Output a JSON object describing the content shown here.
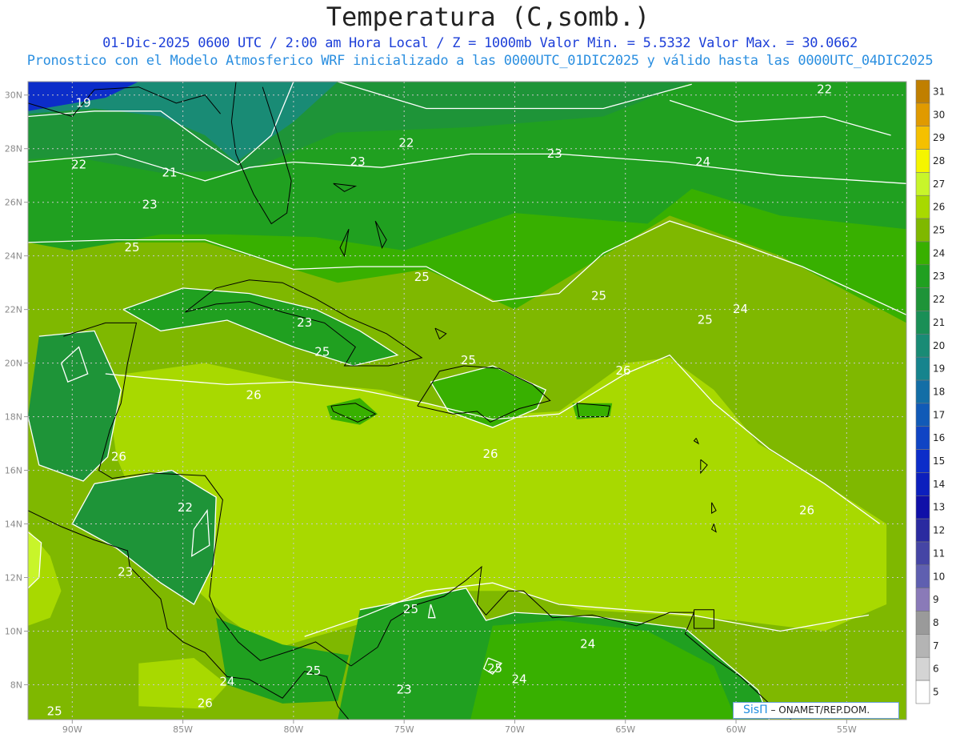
{
  "title": "Temperatura (C,somb.)",
  "subtitle1": "01-Dic-2025  0600 UTC / 2:00 am Hora Local / Z = 1000mb    Valor Min. = 5.5332  Valor Max. = 30.0662",
  "subtitle2": "Pronostico con el Modelo Atmosferico WRF inicializado a las 0000UTC_01DIC2025 y válido hasta las  0000UTC_04DIC2025",
  "credit": {
    "logo": "SisΠ",
    "text": "– ONAMET/REP.DOM."
  },
  "axes": {
    "lon_labels": [
      "90W",
      "85W",
      "80W",
      "75W",
      "70W",
      "65W",
      "60W",
      "55W"
    ],
    "lat_labels": [
      "30N",
      "28N",
      "26N",
      "24N",
      "22N",
      "20N",
      "18N",
      "16N",
      "14N",
      "12N",
      "10N",
      "8N"
    ],
    "lon_range": [
      -92,
      -52.3
    ],
    "lat_range": [
      6.7,
      30.5
    ],
    "grid": "dotted"
  },
  "colorbar": {
    "levels": [
      31,
      30,
      29,
      28,
      27,
      26,
      25,
      24,
      23,
      22,
      21,
      20,
      19,
      18,
      17,
      16,
      15,
      14,
      13,
      12,
      11,
      10,
      9,
      8,
      7,
      6,
      5
    ],
    "colors": [
      "#c07f00",
      "#e09a00",
      "#f5c000",
      "#f5f500",
      "#c8f52a",
      "#a8d900",
      "#7fb800",
      "#38b000",
      "#20a020",
      "#1e9438",
      "#1a8f56",
      "#198b75",
      "#16848d",
      "#136ea6",
      "#115ab7",
      "#0f44c4",
      "#0c2dc9",
      "#0c1fbd",
      "#1010a8",
      "#2a2aa0",
      "#4545a5",
      "#5f5fb0",
      "#8a7ab8",
      "#9a9a9a",
      "#b4b4b4",
      "#d4d4d4",
      "#ffffff"
    ]
  },
  "contour_labels": [
    {
      "text": "19",
      "lon": -89.5,
      "lat": 29.7
    },
    {
      "text": "22",
      "lon": -56.0,
      "lat": 30.2
    },
    {
      "text": "22",
      "lon": -74.9,
      "lat": 28.2
    },
    {
      "text": "22",
      "lon": -89.7,
      "lat": 27.4
    },
    {
      "text": "21",
      "lon": -85.6,
      "lat": 27.1
    },
    {
      "text": "23",
      "lon": -77.1,
      "lat": 27.5
    },
    {
      "text": "23",
      "lon": -68.2,
      "lat": 27.8
    },
    {
      "text": "24",
      "lon": -61.5,
      "lat": 27.5
    },
    {
      "text": "23",
      "lon": -86.5,
      "lat": 25.9
    },
    {
      "text": "25",
      "lon": -87.3,
      "lat": 24.3
    },
    {
      "text": "25",
      "lon": -74.2,
      "lat": 23.2
    },
    {
      "text": "25",
      "lon": -66.2,
      "lat": 22.5
    },
    {
      "text": "24",
      "lon": -59.8,
      "lat": 22.0
    },
    {
      "text": "25",
      "lon": -61.4,
      "lat": 21.6
    },
    {
      "text": "23",
      "lon": -79.5,
      "lat": 21.5
    },
    {
      "text": "25",
      "lon": -78.7,
      "lat": 20.4
    },
    {
      "text": "25",
      "lon": -72.1,
      "lat": 20.1
    },
    {
      "text": "26",
      "lon": -65.1,
      "lat": 19.7
    },
    {
      "text": "26",
      "lon": -81.8,
      "lat": 18.8
    },
    {
      "text": "26",
      "lon": -71.1,
      "lat": 16.6
    },
    {
      "text": "26",
      "lon": -87.9,
      "lat": 16.5
    },
    {
      "text": "22",
      "lon": -84.9,
      "lat": 14.6
    },
    {
      "text": "26",
      "lon": -56.8,
      "lat": 14.5
    },
    {
      "text": "23",
      "lon": -87.6,
      "lat": 12.2
    },
    {
      "text": "25",
      "lon": -74.7,
      "lat": 10.8
    },
    {
      "text": "24",
      "lon": -66.7,
      "lat": 9.5
    },
    {
      "text": "25",
      "lon": -70.9,
      "lat": 8.6
    },
    {
      "text": "24",
      "lon": -69.8,
      "lat": 8.2
    },
    {
      "text": "25",
      "lon": -79.1,
      "lat": 8.5
    },
    {
      "text": "24",
      "lon": -83.0,
      "lat": 8.1
    },
    {
      "text": "23",
      "lon": -75.0,
      "lat": 7.8
    },
    {
      "text": "26",
      "lon": -84.0,
      "lat": 7.3
    },
    {
      "text": "25",
      "lon": -90.8,
      "lat": 7.0
    }
  ]
}
